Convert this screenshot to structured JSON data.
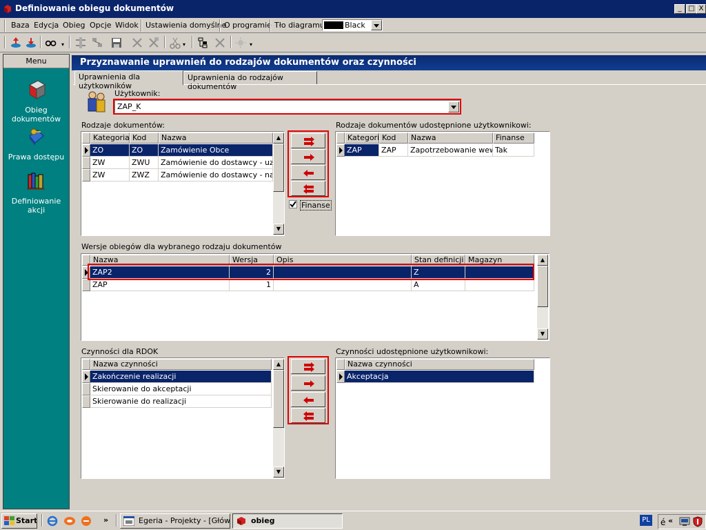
{
  "window": {
    "title": "Definiowanie obiegu dokumentów",
    "buttons": [
      "_",
      "□",
      "X"
    ]
  },
  "menu": {
    "items": [
      "Baza",
      "Edycja",
      "Obieg",
      "Opcje",
      "Widok",
      "Ustawienia domyślne",
      "O programie",
      "Tło diagramu"
    ],
    "color_value": "Black"
  },
  "left_menu": {
    "header": "Menu",
    "items": [
      {
        "label": "Obieg dokumentów",
        "icon": "cube-document-icon"
      },
      {
        "label": "Prawa dostępu",
        "icon": "key-book-icon"
      },
      {
        "label": "Definiowanie akcji",
        "icon": "books-icon"
      }
    ]
  },
  "main": {
    "header": "Przyznawanie uprawnień do rodzajów dokumentów oraz czynności",
    "tabs": [
      "Uprawnienia dla użytkowników",
      "Uprawnienia do rodzajów dokumentów"
    ],
    "user_label": "Użytkownik:",
    "user_value": "ZAP_K"
  },
  "doc_types": {
    "label": "Rodzaje dokumentów:",
    "columns": [
      "Kategoria",
      "Kod",
      "Nazwa"
    ],
    "rows": [
      [
        "ZO",
        "ZO",
        "Zamówienie Obce"
      ],
      [
        "ZW",
        "ZWU",
        "Zamówienie do dostawcy - uzupełn"
      ],
      [
        "ZW",
        "ZWZ",
        "Zamówienie do dostawcy - na pods"
      ]
    ]
  },
  "shared_doc_types": {
    "label": "Rodzaje dokumentów udostępnione użytkownikowi:",
    "columns": [
      "Kategoria",
      "Kod",
      "Nazwa",
      "Finanse"
    ],
    "rows": [
      [
        "ZAP",
        "ZAP",
        "Zapotrzebowanie wewnę",
        "Tak"
      ]
    ]
  },
  "finance_checkbox": {
    "label": "Finanse",
    "checked": true
  },
  "versions": {
    "label": "Wersje obiegów dla wybranego rodzaju dokumentów",
    "columns": [
      "Nazwa",
      "Wersja",
      "Opis",
      "Stan definicji",
      "Magazyn"
    ],
    "rows": [
      [
        "ZAP2",
        "2",
        "",
        "Z",
        ""
      ],
      [
        "ZAP",
        "1",
        "",
        "A",
        ""
      ]
    ]
  },
  "activities": {
    "label": "Czynności dla RDOK",
    "columns": [
      "Nazwa czynności"
    ],
    "rows": [
      [
        "Zakończenie realizacji"
      ],
      [
        "Skierowanie do akceptacji"
      ],
      [
        "Skierowanie do realizacji"
      ]
    ]
  },
  "shared_activities": {
    "label": "Czynności udostępnione użytkownikowi:",
    "columns": [
      "Nazwa czynności"
    ],
    "rows": [
      [
        "Akceptacja"
      ]
    ]
  },
  "taskbar": {
    "start": "Start",
    "tasks": [
      "Egeria - Projekty - [Głów...",
      "obieg"
    ],
    "lang": "PL",
    "chevrons": "»",
    "tray_chevrons": "«"
  },
  "colors": {
    "title_bar": "#0a246a",
    "side_panel": "#008080",
    "highlight_box": "#e00000"
  }
}
